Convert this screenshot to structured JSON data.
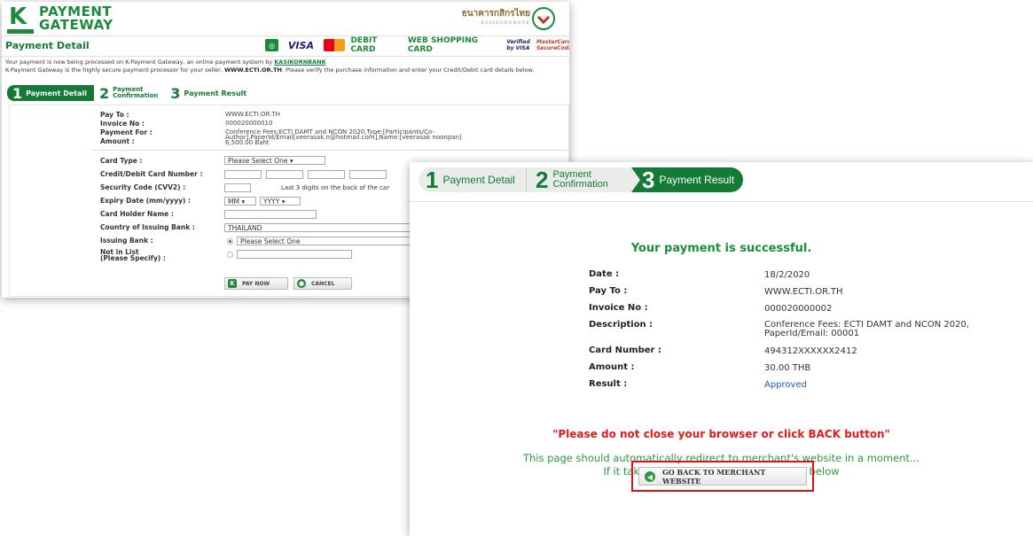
{
  "left": {
    "brand_line1": "PAYMENT",
    "brand_line2": "GATEWAY",
    "thai_bank_name": "ธนาคารกสิกรไทย",
    "thai_bank_sub": "KASIKORNBANK",
    "page_title": "Payment Detail",
    "card_logos": [
      "VISA",
      "DEBIT CARD",
      "WEB SHOPPING CARD",
      "Verified by VISA",
      "MasterCard SecureCode"
    ],
    "intro": {
      "part1": "Your payment is now being processed on K-Payment Gateway, an online payment system by ",
      "bank_link": "KASIKORNBANK",
      "part2": "K-Payment Gateway is the highly secure payment processor for your seller, ",
      "seller": "WWW.ECTI.OR.TH",
      "part3": ". Please verify the purchase information and enter your Credit/Debit card details below."
    },
    "steps": [
      {
        "num": "1",
        "label": "Payment Detail"
      },
      {
        "num": "2",
        "label1": "Payment",
        "label2": "Confirmation"
      },
      {
        "num": "3",
        "label": "Payment Result"
      }
    ],
    "summary": {
      "pay_to_label": "Pay To :",
      "pay_to": "WWW.ECTI.OR.TH",
      "invoice_label": "Invoice No :",
      "invoice": "000020000010",
      "payment_for_label": "Payment For :",
      "payment_for_1": "Conference Fees:ECTI DAMT and NCON 2020,Type:[Participants/Co-",
      "payment_for_2": "Author],PaperId/Email[veerasak.n@hotmail.com],Name:[veerasak noonpan]",
      "amount_label": "Amount :",
      "amount": "6,500.00 Baht"
    },
    "form": {
      "card_type_label": "Card Type :",
      "card_type_value": "Please Select One ▾",
      "card_number_label": "Credit/Debit Card Number :",
      "cvv_label": "Security Code (CVV2) :",
      "cvv_hint": "Last 3 digits on the back of the car",
      "expiry_label": "Expiry Date (mm/yyyy) :",
      "expiry_mm": "MM ▾",
      "expiry_yyyy": "YYYY ▾",
      "holder_label": "Card Holder Name :",
      "country_label": "Country of Issuing Bank :",
      "country_value": "THAILAND",
      "issuing_label": "Issuing Bank :",
      "issuing_value": "Please Select One",
      "notlist_label1": "Not in List",
      "notlist_label2": "(Please Specify) :",
      "pay_now": "PAY NOW",
      "cancel": "CANCEL"
    }
  },
  "right": {
    "steps": [
      {
        "num": "1",
        "label": "Payment Detail"
      },
      {
        "num": "2",
        "label1": "Payment",
        "label2": "Confirmation"
      },
      {
        "num": "3",
        "label": "Payment Result"
      }
    ],
    "success": "Your payment is successful.",
    "rows": [
      {
        "label": "Date :",
        "value": "18/2/2020"
      },
      {
        "label": "Pay To :",
        "value": "WWW.ECTI.OR.TH"
      },
      {
        "label": "Invoice No :",
        "value": "000020000002"
      },
      {
        "label": "Description :",
        "value1": "Conference Fees: ECTI DAMT and NCON 2020,",
        "value2": "PaperId/Email: 00001"
      },
      {
        "label": "Card Number :",
        "value": "494312XXXXXX2412"
      },
      {
        "label": "Amount :",
        "value": "30.00 THB"
      },
      {
        "label": "Result :",
        "value": "Approved"
      }
    ],
    "warning": "\"Please do not close your browser or click BACK button\"",
    "redirect1": "This page should automatically redirect to merchant's website in a moment...",
    "redirect2": "If it takes longer,please click the button below",
    "back_button": "GO BACK TO MERCHANT WEBSITE"
  },
  "colors": {
    "brand_green": "#137b35",
    "warning_red": "#e11a1a",
    "result_blue": "#2156b8"
  }
}
